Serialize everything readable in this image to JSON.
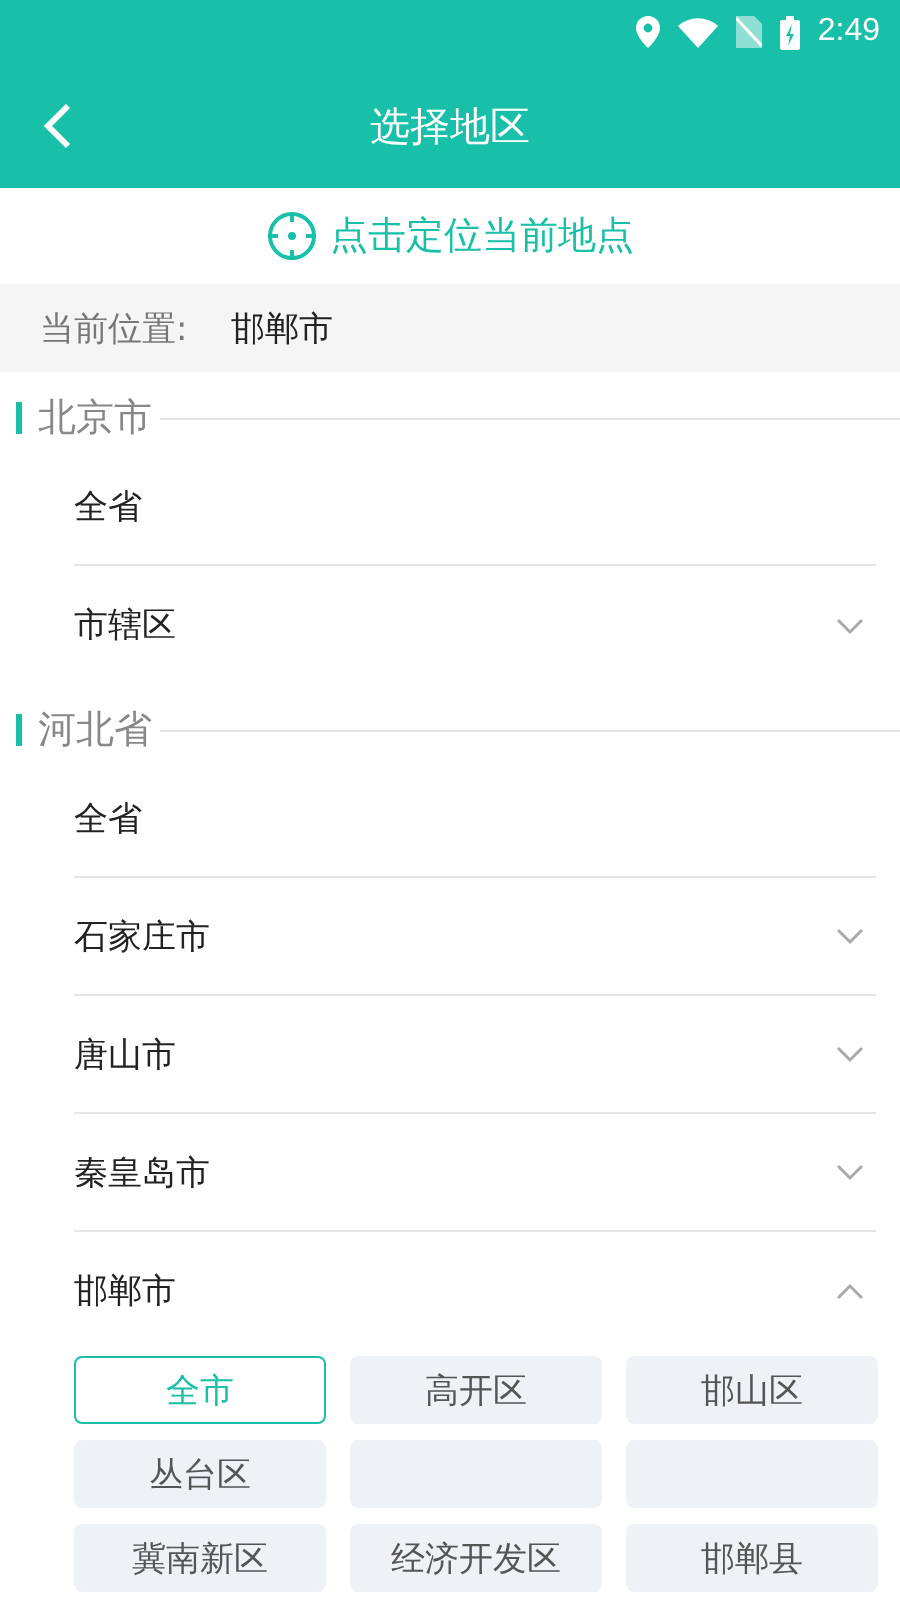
{
  "status_bar": {
    "time": "2:49"
  },
  "header": {
    "title": "选择地区"
  },
  "locate": {
    "label": "点击定位当前地点"
  },
  "current": {
    "label": "当前位置:",
    "value": "邯郸市"
  },
  "provinces": [
    {
      "name": "北京市",
      "cities": [
        {
          "name": "全省",
          "kind": "plain"
        },
        {
          "name": "市辖区",
          "kind": "expandable",
          "expanded": false
        }
      ]
    },
    {
      "name": "河北省",
      "cities": [
        {
          "name": "全省",
          "kind": "plain"
        },
        {
          "name": "石家庄市",
          "kind": "expandable",
          "expanded": false
        },
        {
          "name": "唐山市",
          "kind": "expandable",
          "expanded": false
        },
        {
          "name": "秦皇岛市",
          "kind": "expandable",
          "expanded": false
        },
        {
          "name": "邯郸市",
          "kind": "expandable",
          "expanded": true,
          "districts": [
            {
              "name": "全市",
              "selected": true
            },
            {
              "name": "高开区",
              "selected": false
            },
            {
              "name": "邯山区",
              "selected": false
            },
            {
              "name": "丛台区",
              "selected": false
            },
            {
              "selected": false
            },
            {
              "selected": false
            },
            {
              "name": "冀南新区",
              "selected": false
            },
            {
              "name": "经济开发区",
              "selected": false
            },
            {
              "name": "邯郸县",
              "selected": false
            }
          ]
        }
      ]
    }
  ]
}
